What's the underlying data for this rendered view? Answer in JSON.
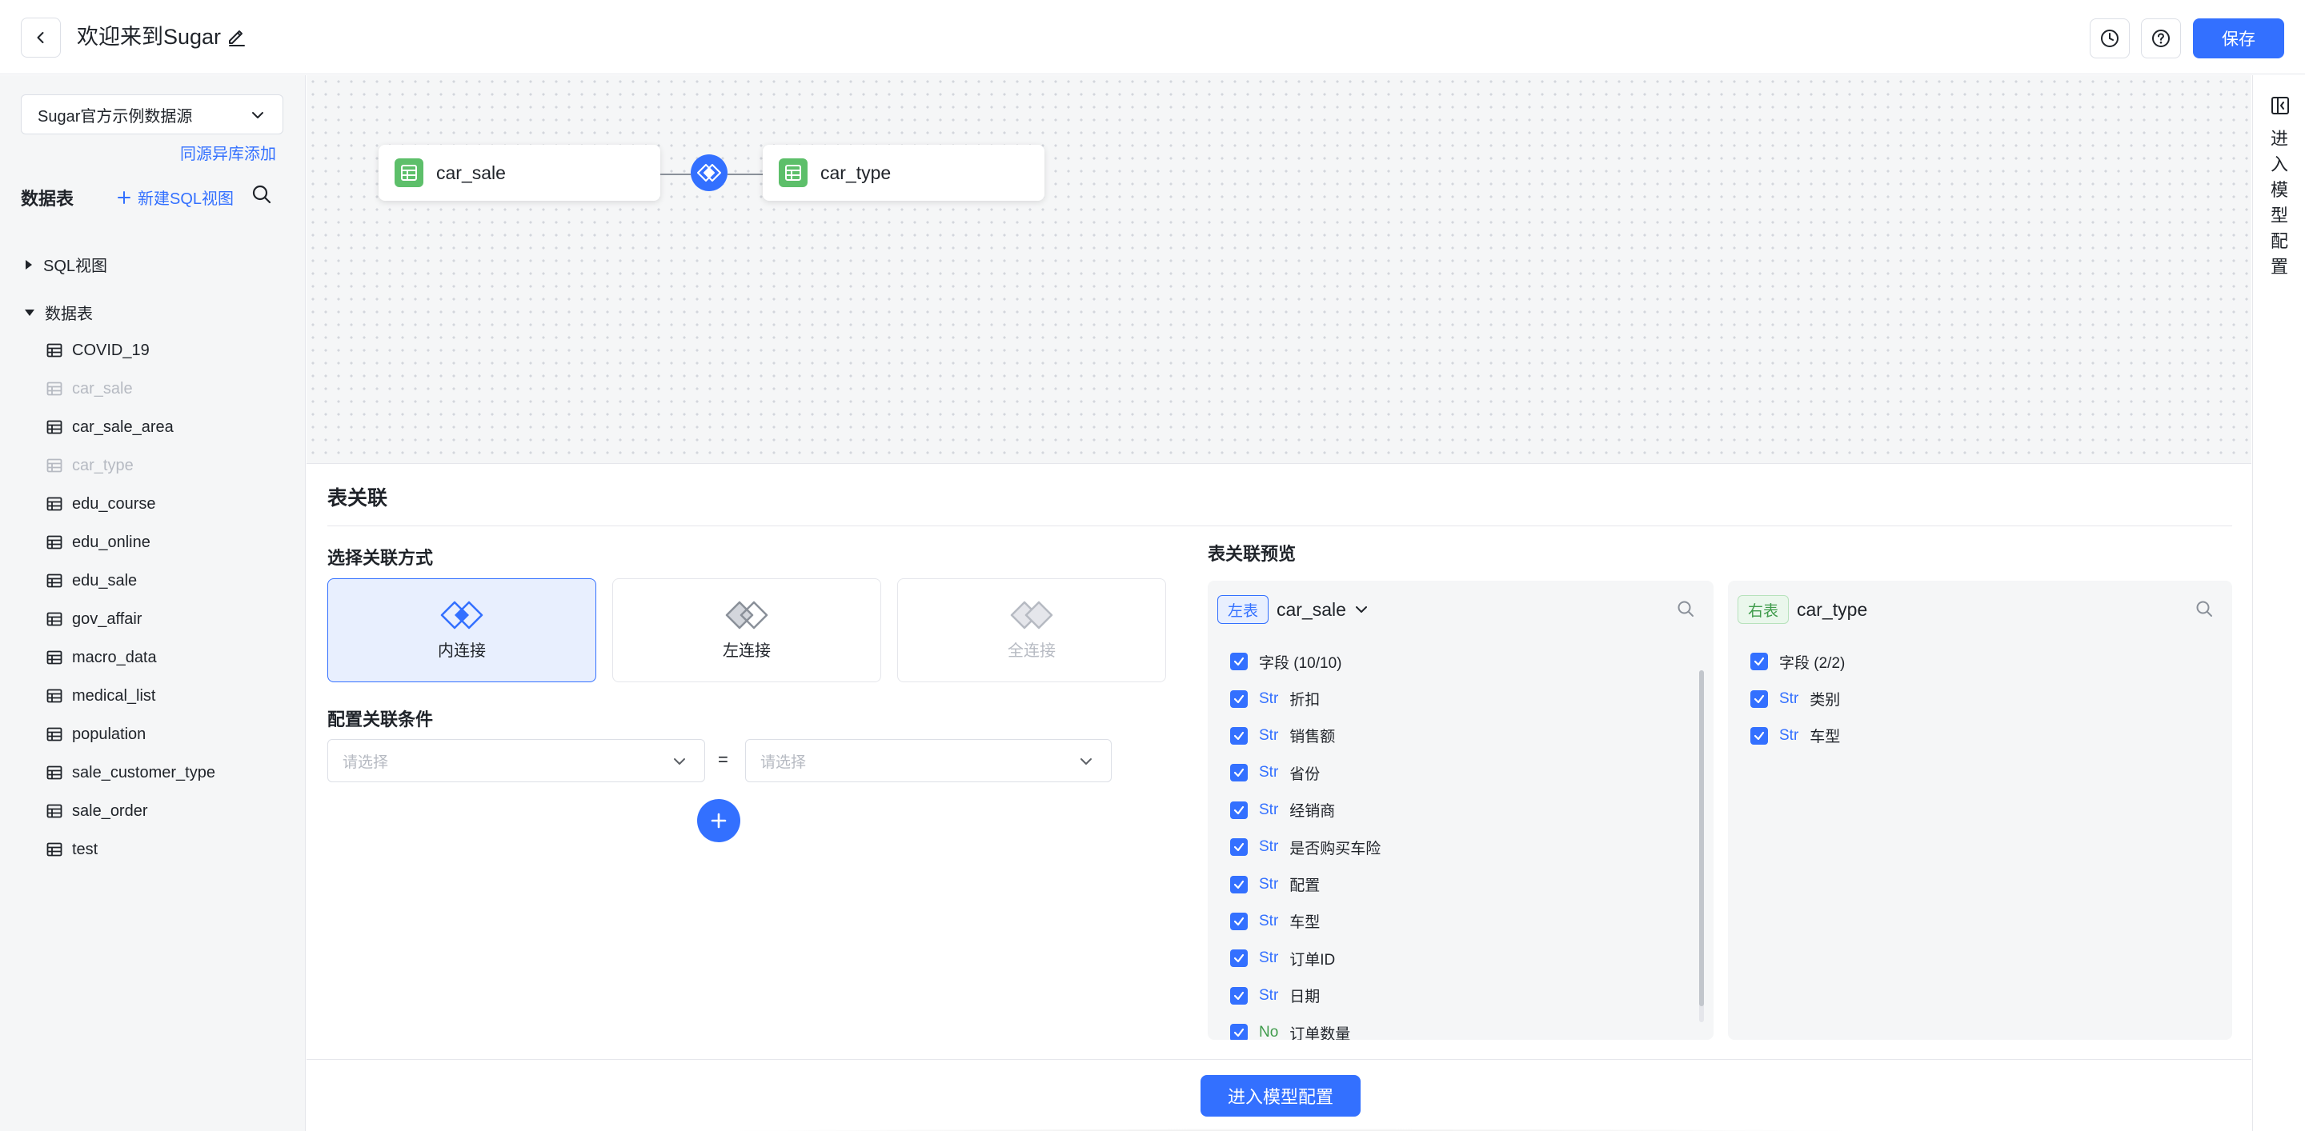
{
  "header": {
    "title": "欢迎来到Sugar",
    "save_label": "保存"
  },
  "sidebar": {
    "datasource": "Sugar官方示例数据源",
    "same_source_add": "同源异库添加",
    "tables_label": "数据表",
    "new_sql_view": "新建SQL视图",
    "groups": {
      "sql_view": "SQL视图",
      "tables": "数据表"
    },
    "tables": [
      "COVID_19",
      "car_sale",
      "car_sale_area",
      "car_type",
      "edu_course",
      "edu_online",
      "edu_sale",
      "gov_affair",
      "macro_data",
      "medical_list",
      "population",
      "sale_customer_type",
      "sale_order",
      "test"
    ]
  },
  "canvas": {
    "left_node": "car_sale",
    "right_node": "car_type"
  },
  "rightbar": {
    "label": "进入模型配置"
  },
  "panel": {
    "title": "表关联",
    "join_method_label": "选择关联方式",
    "join_types": [
      "内连接",
      "左连接",
      "全连接"
    ],
    "condition_label": "配置关联条件",
    "placeholder": "请选择",
    "equals": "=",
    "preview_label": "表关联预览",
    "left": {
      "tag": "左表",
      "name": "car_sale",
      "field_summary": "字段 (10/10)",
      "fields": [
        {
          "type": "Str",
          "name": "折扣"
        },
        {
          "type": "Str",
          "name": "销售额"
        },
        {
          "type": "Str",
          "name": "省份"
        },
        {
          "type": "Str",
          "name": "经销商"
        },
        {
          "type": "Str",
          "name": "是否购买车险"
        },
        {
          "type": "Str",
          "name": "配置"
        },
        {
          "type": "Str",
          "name": "车型"
        },
        {
          "type": "Str",
          "name": "订单ID"
        },
        {
          "type": "Str",
          "name": "日期"
        },
        {
          "type": "No",
          "name": "订单数量"
        }
      ]
    },
    "right": {
      "tag": "右表",
      "name": "car_type",
      "field_summary": "字段 (2/2)",
      "fields": [
        {
          "type": "Str",
          "name": "类别"
        },
        {
          "type": "Str",
          "name": "车型"
        }
      ]
    }
  },
  "footer": {
    "enter_model_config": "进入模型配置"
  },
  "colors": {
    "primary": "#3370ff",
    "table_icon": "#5dbf6a",
    "muted": "#b6bac2"
  }
}
